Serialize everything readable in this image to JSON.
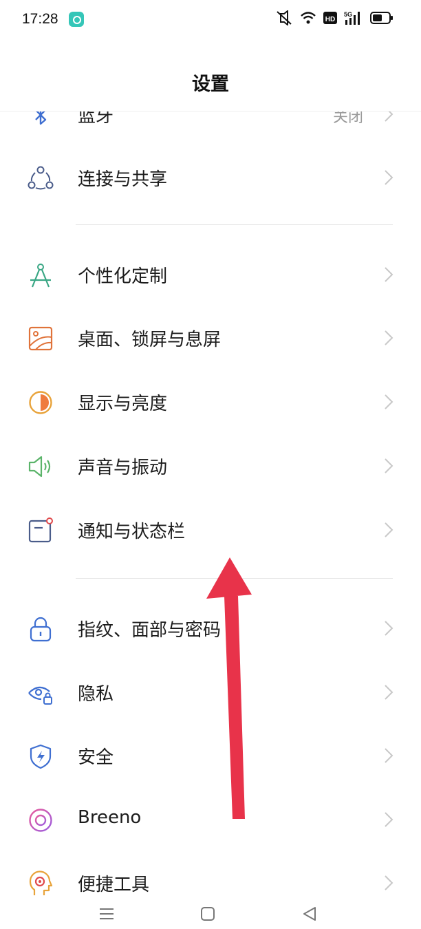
{
  "status_bar": {
    "time": "17:28",
    "icons": [
      "app-notification-icon",
      "mute-icon",
      "wifi-icon",
      "hd-icon",
      "5g-signal-icon",
      "battery-icon"
    ],
    "hd_label": "HD",
    "network_label": "5G"
  },
  "header": {
    "title": "设置"
  },
  "settings": {
    "bluetooth": {
      "label": "蓝牙",
      "value": "关闭",
      "icon": "bluetooth-icon"
    },
    "items": [
      {
        "label": "连接与共享",
        "icon": "share-network-icon"
      },
      {
        "label": "个性化定制",
        "icon": "compass-icon"
      },
      {
        "label": "桌面、锁屏与息屏",
        "icon": "wallpaper-icon"
      },
      {
        "label": "显示与亮度",
        "icon": "brightness-icon"
      },
      {
        "label": "声音与振动",
        "icon": "speaker-icon"
      },
      {
        "label": "通知与状态栏",
        "icon": "notification-icon"
      },
      {
        "label": "指纹、面部与密码",
        "icon": "lock-icon"
      },
      {
        "label": "隐私",
        "icon": "privacy-eye-icon"
      },
      {
        "label": "安全",
        "icon": "shield-icon"
      },
      {
        "label": "Breeno",
        "icon": "breeno-icon"
      },
      {
        "label": "便捷工具",
        "icon": "convenience-tools-icon"
      }
    ]
  },
  "annotation": {
    "arrow_direction": "up",
    "arrow_color": "#e8334a"
  },
  "navigation": {
    "buttons": [
      "menu-icon",
      "home-icon",
      "back-icon"
    ]
  },
  "colors": {
    "chevron": "#c8c8c8",
    "value_text": "#9a9a9a",
    "divider": "#e6e6e6"
  }
}
